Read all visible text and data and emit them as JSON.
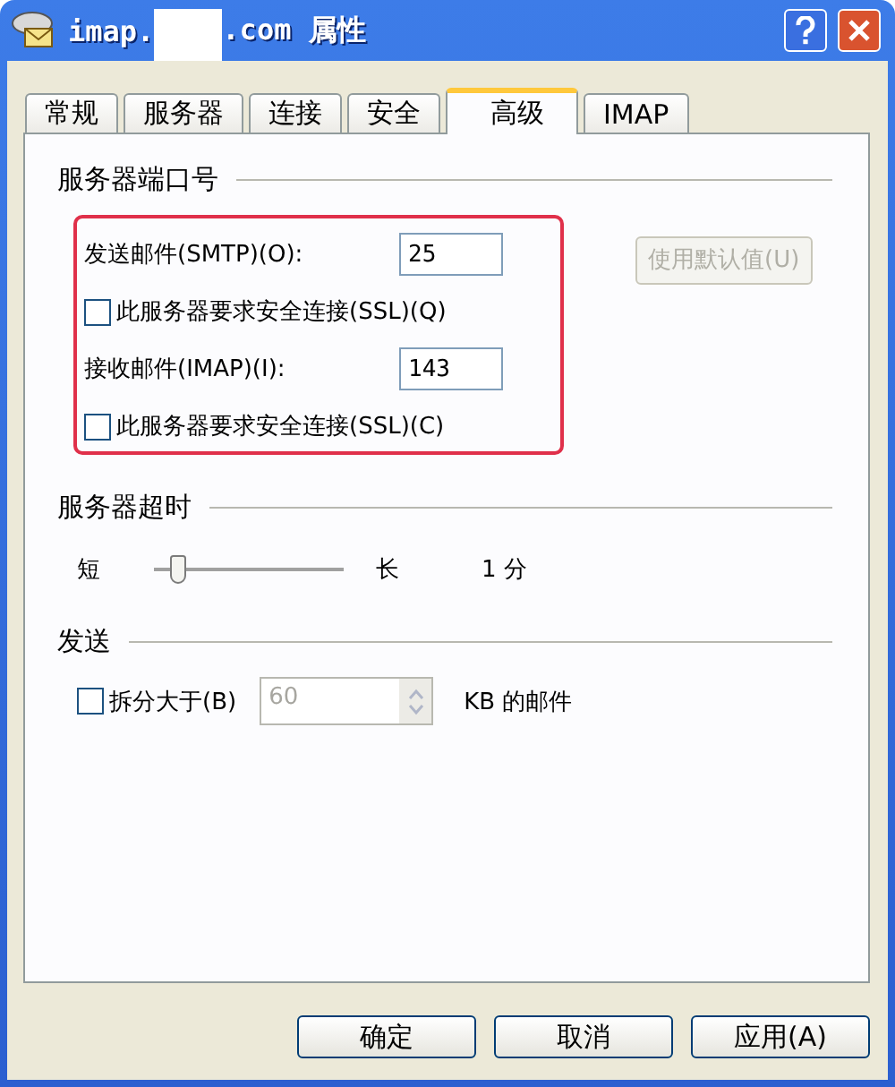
{
  "window": {
    "title_start": "imap.",
    "title_end": ".com 属性",
    "redacted": true
  },
  "tabs": [
    {
      "label": "常规",
      "selected": false
    },
    {
      "label": "服务器",
      "selected": false
    },
    {
      "label": "连接",
      "selected": false
    },
    {
      "label": "安全",
      "selected": false
    },
    {
      "label": "高级",
      "selected": true
    },
    {
      "label": "IMAP",
      "selected": false
    }
  ],
  "ports": {
    "title": "服务器端口号",
    "highlighted": true,
    "outgoing": {
      "label": "发送邮件(SMTP)(O):",
      "value": "25"
    },
    "outgoing_ssl": {
      "label": "此服务器要求安全连接(SSL)(Q)",
      "checked": false
    },
    "incoming": {
      "label": "接收邮件(IMAP)(I):",
      "value": "143"
    },
    "incoming_ssl": {
      "label": "此服务器要求安全连接(SSL)(C)",
      "checked": false
    },
    "default_button": {
      "label": "使用默认值(U)",
      "disabled": true
    }
  },
  "timeout": {
    "title": "服务器超时",
    "short_label": "短",
    "long_label": "长",
    "level": 0.12,
    "reading": "1 分"
  },
  "sending": {
    "title": "发送",
    "split": {
      "label": "拆分大于(B)",
      "checked": false
    },
    "size": {
      "value": "60",
      "disabled": true
    },
    "unit": "KB 的邮件"
  },
  "buttons": [
    {
      "label": "确定"
    },
    {
      "label": "取消"
    },
    {
      "label": "应用(A)"
    }
  ]
}
